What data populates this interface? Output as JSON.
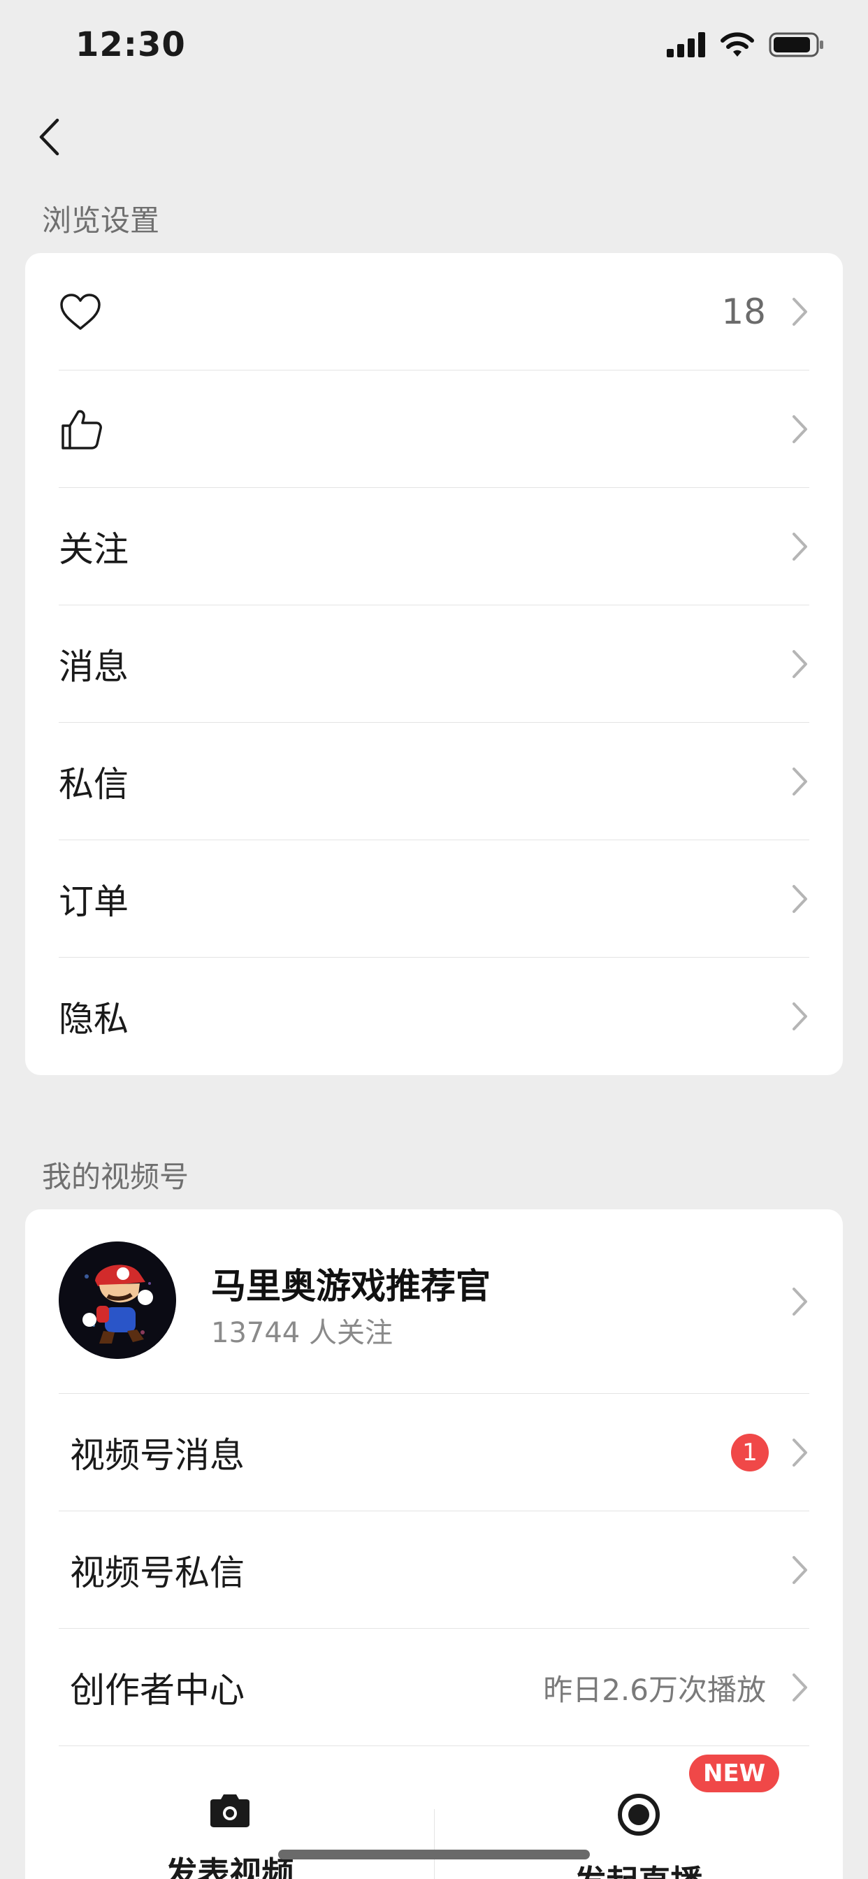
{
  "status_bar": {
    "time": "12:30"
  },
  "browse_section": {
    "title": "浏览设置",
    "items": [
      {
        "icon": "heart-icon",
        "value": "18"
      },
      {
        "icon": "thumbs-up-icon"
      },
      {
        "label": "关注"
      },
      {
        "label": "消息"
      },
      {
        "label": "私信"
      },
      {
        "label": "订单"
      },
      {
        "label": "隐私"
      }
    ]
  },
  "channel_section": {
    "title": "我的视频号",
    "profile": {
      "name": "马里奥游戏推荐官",
      "followers": "13744 人关注"
    },
    "items": [
      {
        "label": "视频号消息",
        "badge": "1"
      },
      {
        "label": "视频号私信"
      },
      {
        "label": "创作者中心",
        "value": "昨日2.6万次播放"
      }
    ],
    "actions": [
      {
        "icon": "camera-icon",
        "label": "发表视频"
      },
      {
        "icon": "live-icon",
        "label": "发起直播",
        "badge": "NEW"
      }
    ]
  },
  "colors": {
    "background": "#ededed",
    "card": "#ffffff",
    "badge": "#f04848"
  }
}
